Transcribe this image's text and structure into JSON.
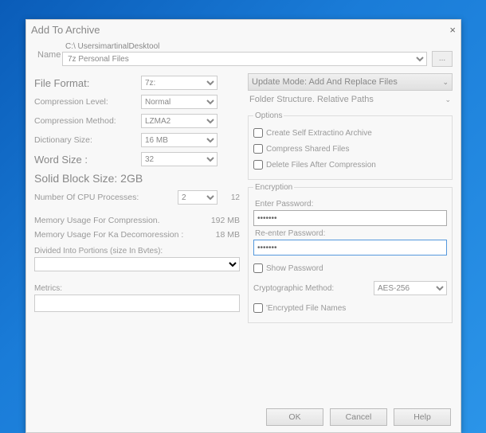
{
  "dialog": {
    "title": "Add To Archive",
    "close": "×"
  },
  "name": {
    "label": "Name",
    "path": "C:\\ UsersimartinalDesktool",
    "archive": "7z Personal Files",
    "browse": "..."
  },
  "left": {
    "file_format": {
      "label": "File Format:",
      "value": "7z:"
    },
    "compression_level": {
      "label": "Compression Level:",
      "value": "Normal"
    },
    "compression_method": {
      "label": "Compression Method:",
      "value": "LZMA2"
    },
    "dictionary_size": {
      "label": "Dictionary Size:",
      "value": "16 MB"
    },
    "word_size": {
      "label": "Word Size :",
      "value": "32"
    },
    "solid_block": "Solid Block Size: 2GB",
    "cpu": {
      "label": "Number Of CPU Processes:",
      "value": "2",
      "suffix": "12"
    },
    "mem_comp": {
      "label": "Memory Usage For Compression.",
      "value": "192 MB"
    },
    "mem_decomp": {
      "label": "Memory Usage For Ka Decomoression :",
      "value": "18 MB"
    },
    "divided_label": "Divided Into Portions (size In Bvtes):",
    "metrics_label": "Metrics:"
  },
  "right": {
    "update_mode": "Update Mode: Add And Replace Files",
    "folder_structure": "Folder Structure.  Relative Paths",
    "options": {
      "legend": "Options",
      "self_extract": "Create Self Extractino Archive",
      "compress_shared": "Compress Shared Files",
      "delete_after": "Delete Files After Compression"
    },
    "encryption": {
      "legend": "Encryption",
      "enter_pw": "Enter Password:",
      "reenter_pw": "Re-enter Password:",
      "pw_value": "•••••••",
      "show_pw": "Show Password",
      "crypto_label": "Cryptographic Method:",
      "crypto_value": "AES-256",
      "encrypt_names": "'Encrypted File Names"
    }
  },
  "buttons": {
    "ok": "OK",
    "cancel": "Cancel",
    "help": "Help"
  }
}
